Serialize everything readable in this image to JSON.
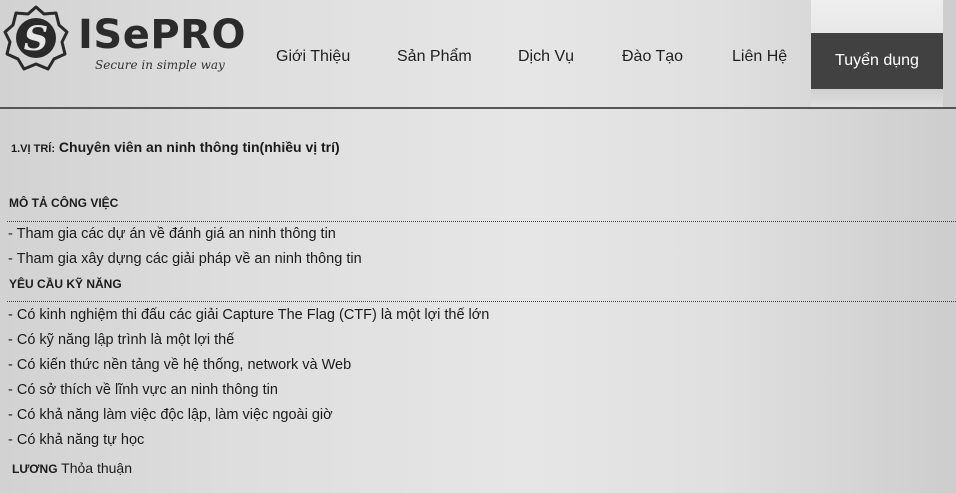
{
  "brand": {
    "name": "ISePRO",
    "tagline": "Secure in simple way",
    "logo_icon": "s-emblem-icon"
  },
  "nav": {
    "items": [
      {
        "label": "Giới Thiệu"
      },
      {
        "label": "Sản Phẩm"
      },
      {
        "label": "Dịch Vụ"
      },
      {
        "label": "Đào Tạo"
      },
      {
        "label": "Liên Hệ"
      },
      {
        "label": "Tuyển dụng",
        "active": true
      }
    ]
  },
  "job": {
    "position_prefix": "1.VỊ TRÍ:",
    "position_title": "Chuyên viên an ninh thông tin(nhiều vị trí)",
    "description_heading": "MÔ TẢ CÔNG VIỆC",
    "description_items": [
      "- Tham gia các dự án về đánh giá an ninh thông tin",
      "- Tham gia xây dựng các giải pháp về an ninh thông tin"
    ],
    "skills_heading": "YÊU CẦU KỸ NĂNG",
    "skills_items": [
      "- Có kinh nghiệm thi đấu các giải Capture The Flag (CTF) là một lợi thế lớn",
      "- Có kỹ năng lập trình là một lợi thế",
      "- Có kiến thức nền tảng về hệ thống, network và Web",
      "- Có sở thích về lĩnh vực an ninh thông tin",
      "- Có khả năng làm việc độc lập, làm việc ngoài giờ",
      "- Có khả năng tự học"
    ],
    "salary_label": "LƯƠNG",
    "salary_value": "Thỏa thuận"
  },
  "colors": {
    "active_tab_bg": "#414141",
    "active_tab_text": "#ffffff",
    "text": "#1b1b1b"
  }
}
